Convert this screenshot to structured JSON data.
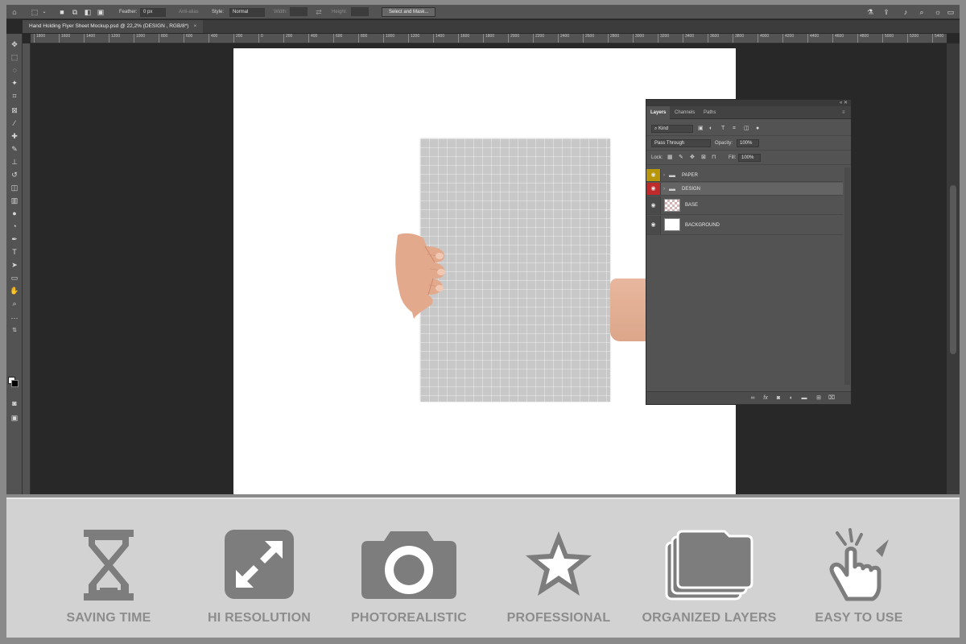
{
  "options_bar": {
    "feather_label": "Feather:",
    "feather_value": "0 px",
    "anti_alias_label": "Anti-alias",
    "style_label": "Style:",
    "style_value": "Normal",
    "width_label": "Width:",
    "height_label": "Height:",
    "select_mask_button": "Select and Mask..."
  },
  "document_tab": {
    "title": "Hand Holding Flyer Sheet Mockup.psd @ 22,2% (DESIGN , RGB/8*)",
    "close": "×"
  },
  "ruler_marks": [
    "1800",
    "1600",
    "1400",
    "1200",
    "1000",
    "800",
    "600",
    "400",
    "200",
    "0",
    "200",
    "400",
    "600",
    "800",
    "1000",
    "1200",
    "1400",
    "1600",
    "1800",
    "2000",
    "2200",
    "2400",
    "2600",
    "2800",
    "3000",
    "3200",
    "3400",
    "3600",
    "3800",
    "4000",
    "4200",
    "4400",
    "4600",
    "4800",
    "5000",
    "5200",
    "5400"
  ],
  "layers_panel": {
    "collapse": "«  ✕",
    "tabs": [
      "Layers",
      "Channels",
      "Paths"
    ],
    "filter_label": "Kind",
    "blend_mode": "Pass Through",
    "opacity_label": "Opacity:",
    "opacity_value": "100%",
    "lock_label": "Lock:",
    "fill_label": "Fill:",
    "fill_value": "100%",
    "layers": [
      {
        "name": "PAPER",
        "type": "group",
        "eye_color": "#b8960b"
      },
      {
        "name": "DESIGN",
        "type": "group",
        "eye_color": "#bf2a2a"
      },
      {
        "name": "BASE",
        "type": "smart"
      },
      {
        "name": "BACKGROUND",
        "type": "pixel"
      }
    ]
  },
  "features": [
    {
      "label": "SAVING TIME",
      "icon": "hourglass-icon"
    },
    {
      "label": "HI RESOLUTION",
      "icon": "expand-arrows-icon"
    },
    {
      "label": "PHOTOREALISTIC",
      "icon": "camera-icon"
    },
    {
      "label": "PROFESSIONAL",
      "icon": "star-icon"
    },
    {
      "label": "ORGANIZED LAYERS",
      "icon": "stacked-folders-icon"
    },
    {
      "label": "EASY TO USE",
      "icon": "pointing-hand-icon"
    }
  ],
  "colors": {
    "feature_icon": "#7d7d7d",
    "feature_text": "#8c8c8c",
    "paper_layer_tag": "#b8960b",
    "design_layer_tag": "#bf2a2a"
  }
}
